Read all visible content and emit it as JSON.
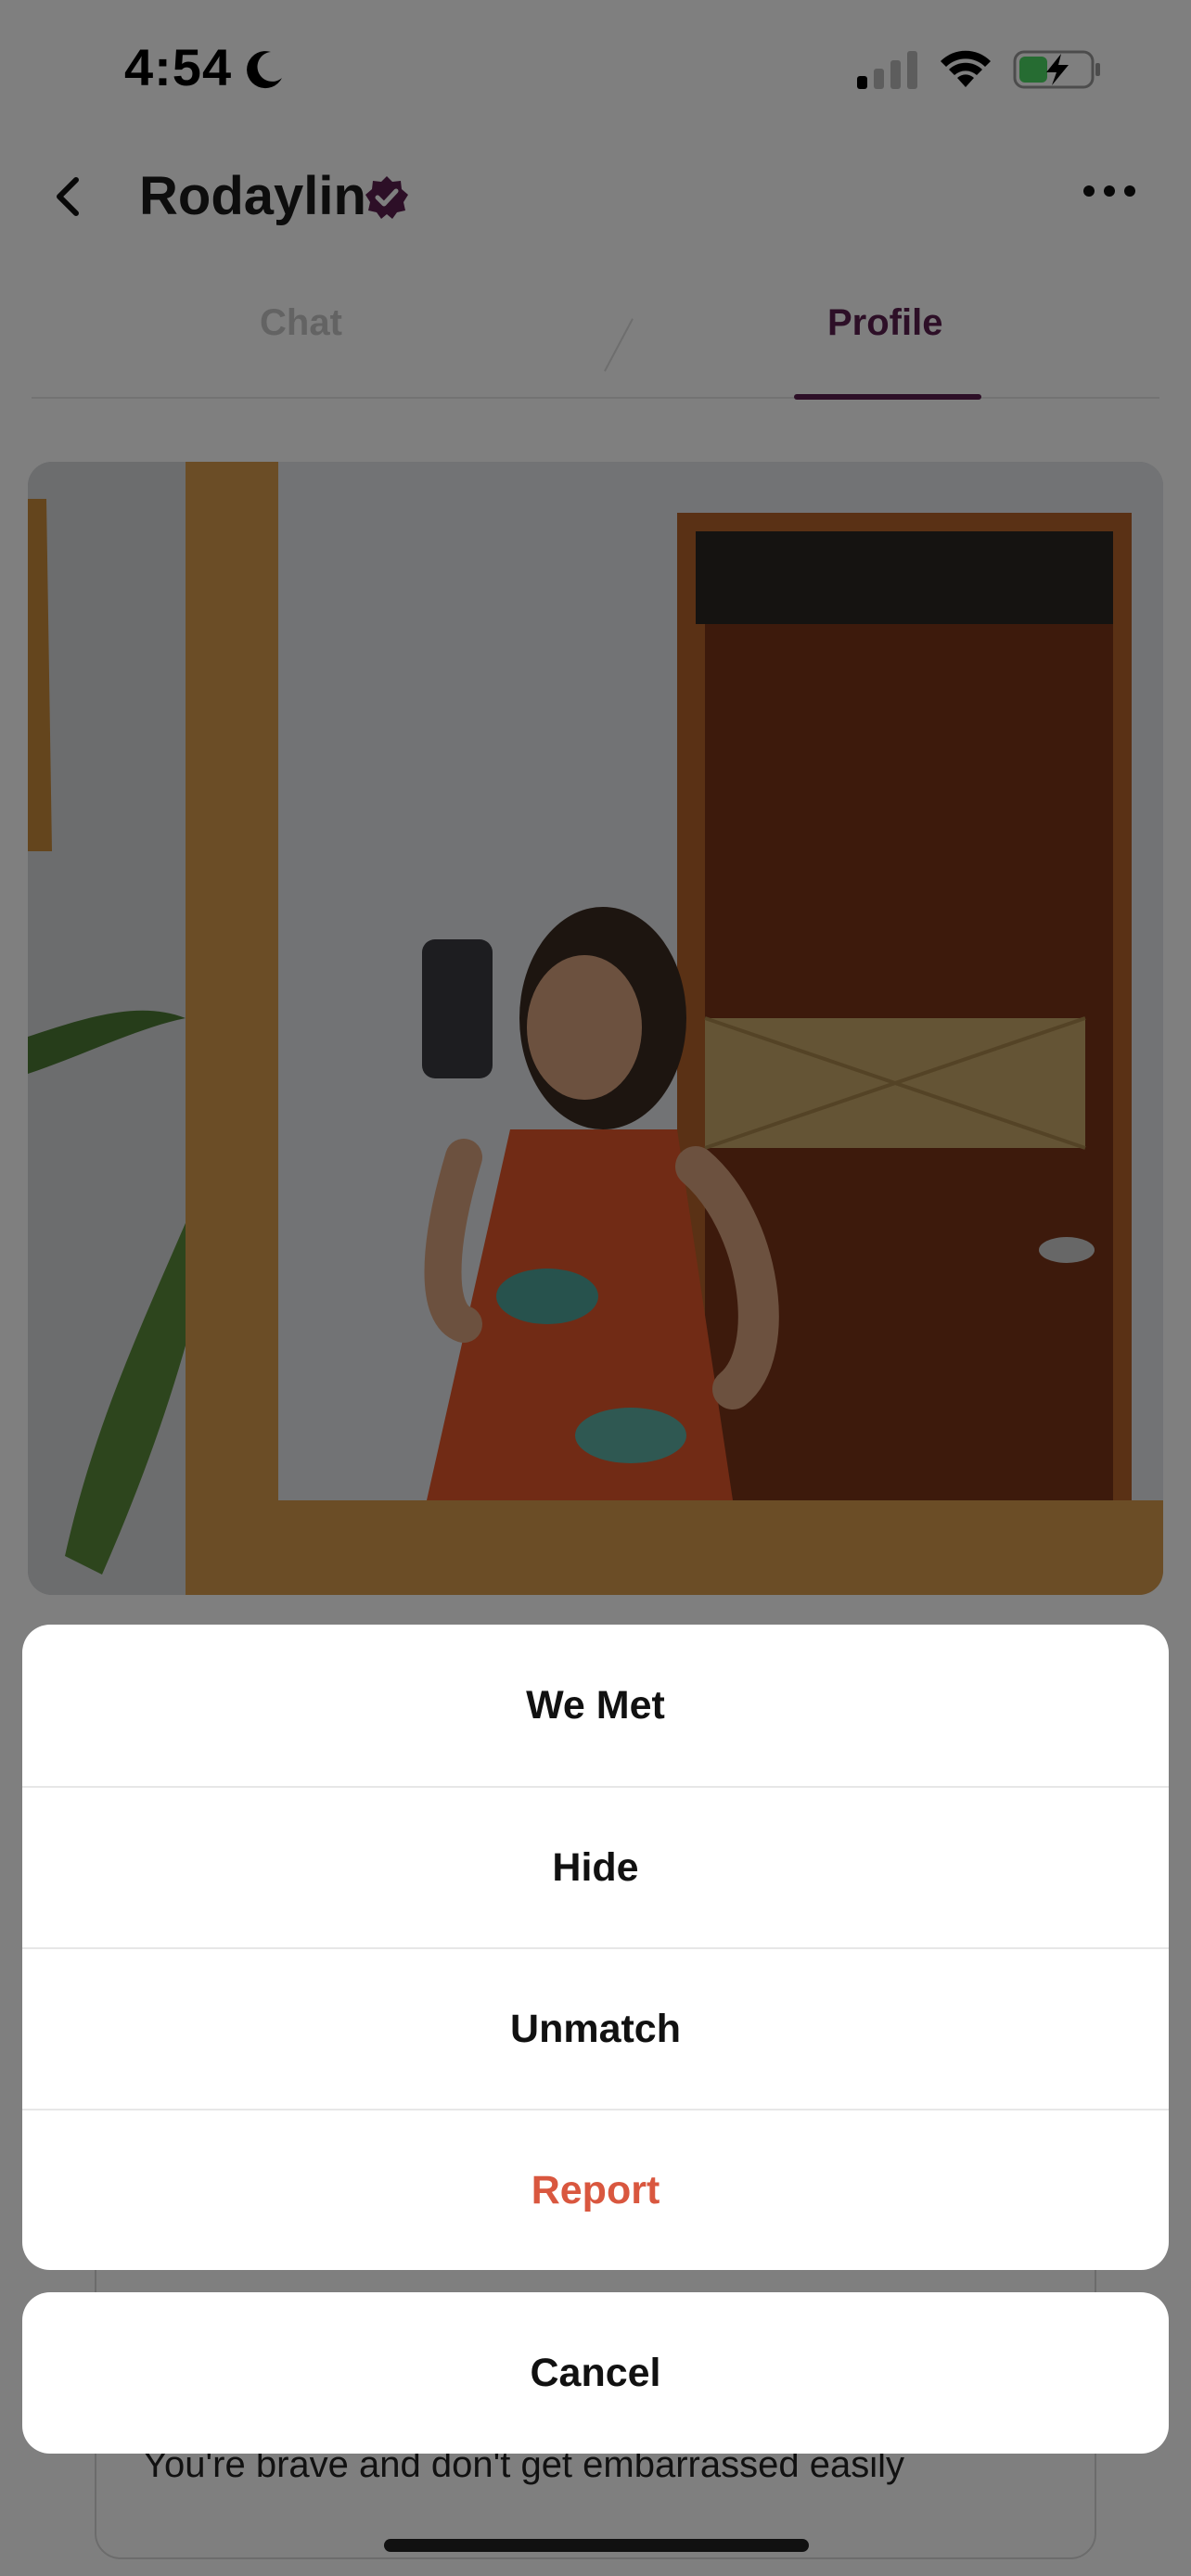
{
  "status_bar": {
    "time": "4:54",
    "icons": [
      "moon-icon",
      "signal-icon",
      "wifi-icon",
      "battery-charging-icon"
    ],
    "battery_color": "#4cd964"
  },
  "header": {
    "name": "Rodaylin",
    "verified_color": "#5a1f4e",
    "icons": [
      "back-icon",
      "verified-badge-icon",
      "more-icon"
    ]
  },
  "tabs": [
    {
      "label": "Chat",
      "active": false
    },
    {
      "label": "Profile",
      "active": true
    }
  ],
  "accent_color": "#5a1f4e",
  "profile": {
    "prompt_answer": "You're brave and don't get embarrassed easily"
  },
  "action_sheet": {
    "items": [
      {
        "label": "We Met",
        "danger": false
      },
      {
        "label": "Hide",
        "danger": false
      },
      {
        "label": "Unmatch",
        "danger": false
      },
      {
        "label": "Report",
        "danger": true
      }
    ],
    "cancel_label": "Cancel",
    "danger_color": "#d9573f"
  }
}
